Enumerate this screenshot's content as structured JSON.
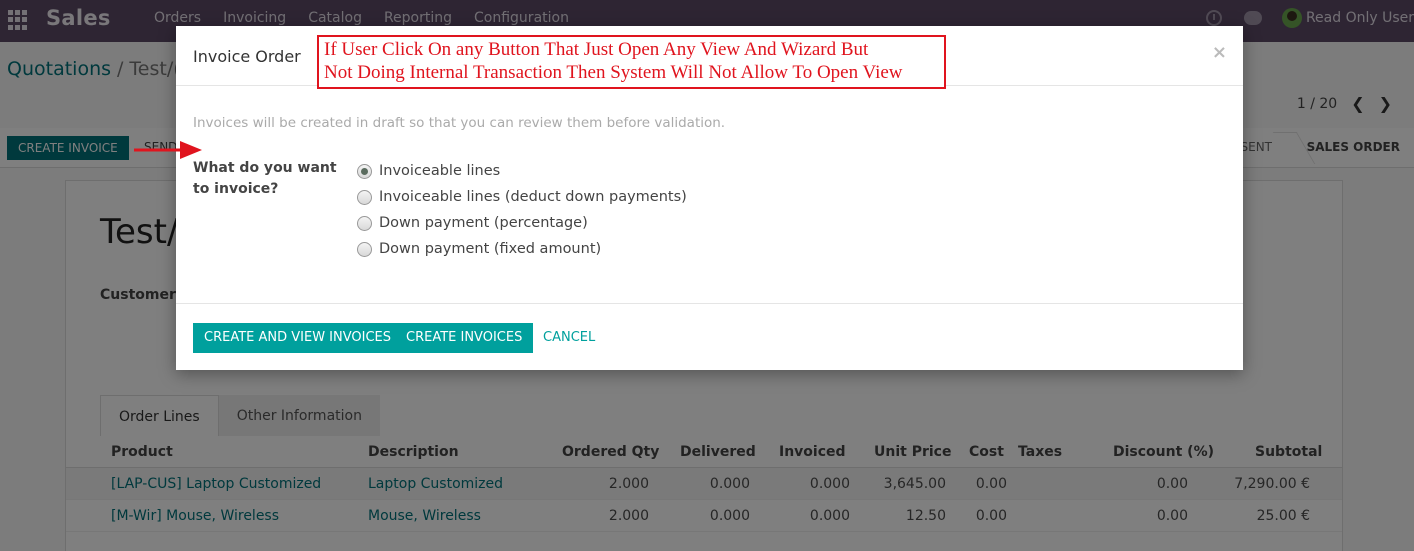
{
  "navbar": {
    "brand": "Sales",
    "menu": [
      "Orders",
      "Invoicing",
      "Catalog",
      "Reporting",
      "Configuration"
    ],
    "user": "Read Only User"
  },
  "breadcrumb": {
    "parent": "Quotations",
    "current": "Test/("
  },
  "pager": {
    "text": "1 / 20"
  },
  "statusbar": {
    "create_invoice": "CREATE INVOICE",
    "send": "SEND",
    "stage_sent": "N SENT",
    "stage_sales_order": "SALES ORDER"
  },
  "form": {
    "title": "Test/",
    "customer_label": "Customer",
    "tabs": [
      "Order Lines",
      "Other Information"
    ]
  },
  "order_lines": {
    "headers": [
      "Product",
      "Description",
      "Ordered Qty",
      "Delivered",
      "Invoiced",
      "Unit Price",
      "Cost",
      "Taxes",
      "Discount (%)",
      "Subtotal"
    ],
    "rows": [
      [
        "[LAP-CUS] Laptop Customized",
        "Laptop Customized",
        "2.000",
        "0.000",
        "0.000",
        "3,645.00",
        "0.00",
        "",
        "0.00",
        "7,290.00 €"
      ],
      [
        "[M-Wir] Mouse, Wireless",
        "Mouse, Wireless",
        "2.000",
        "0.000",
        "0.000",
        "12.50",
        "0.00",
        "",
        "0.00",
        "25.00 €"
      ]
    ]
  },
  "modal": {
    "title": "Invoice Order",
    "close": "×",
    "annotation_line1": "If User Click On any Button That Just Open Any View And Wizard But",
    "annotation_line2": "Not Doing Internal Transaction Then System Will Not Allow To Open View",
    "hint": "Invoices will be created in draft so that you can review them before validation.",
    "question": "What do you want to invoice?",
    "options": [
      {
        "label": "Invoiceable lines",
        "checked": true
      },
      {
        "label": "Invoiceable lines (deduct down payments)",
        "checked": false
      },
      {
        "label": "Down payment (percentage)",
        "checked": false
      },
      {
        "label": "Down payment (fixed amount)",
        "checked": false
      }
    ],
    "buttons": {
      "create_and_view": "CREATE AND VIEW INVOICES",
      "create": "CREATE INVOICES",
      "cancel": "CANCEL"
    }
  },
  "colors": {
    "navbar": "#5c4a66",
    "primary": "#00a09d",
    "link": "#00727a",
    "annotation": "#e0141e"
  }
}
